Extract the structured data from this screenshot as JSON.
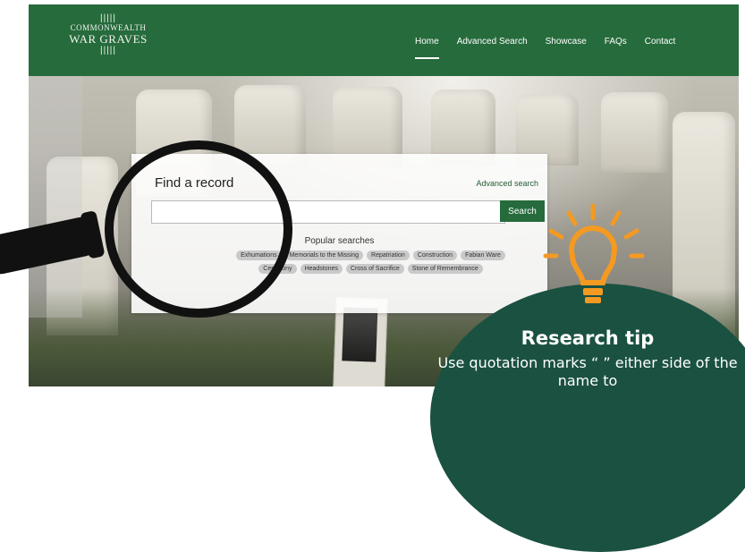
{
  "logo": {
    "bars_top": "|||||",
    "line1": "COMMONWEALTH",
    "line2": "WAR GRAVES",
    "bars_bottom": "|||||"
  },
  "nav": {
    "items": [
      "Home",
      "Advanced Search",
      "Showcase",
      "FAQs",
      "Contact"
    ],
    "active": "Home"
  },
  "search_panel": {
    "title": "Find a record",
    "advanced_link": "Advanced search",
    "input_value": "",
    "search_button": "Search",
    "popular_title": "Popular searches",
    "popular_searches": [
      "Exhumations",
      "Memorials to the Missing",
      "Repatriation",
      "Construction",
      "Fabian Ware",
      "Ceremony",
      "Headstones",
      "Cross of Sacrifice",
      "Stone of Remembrance"
    ]
  },
  "research_tip": {
    "title": "Research tip",
    "text": "Use quotation marks “ ” either side of the name to"
  },
  "colors": {
    "header_green": "#266b3c",
    "button_green": "#256b3b",
    "tip_green": "#1b5141",
    "bulb_orange": "#f49a22"
  },
  "icons": [
    "magnifying-glass-icon",
    "lightbulb-icon"
  ]
}
